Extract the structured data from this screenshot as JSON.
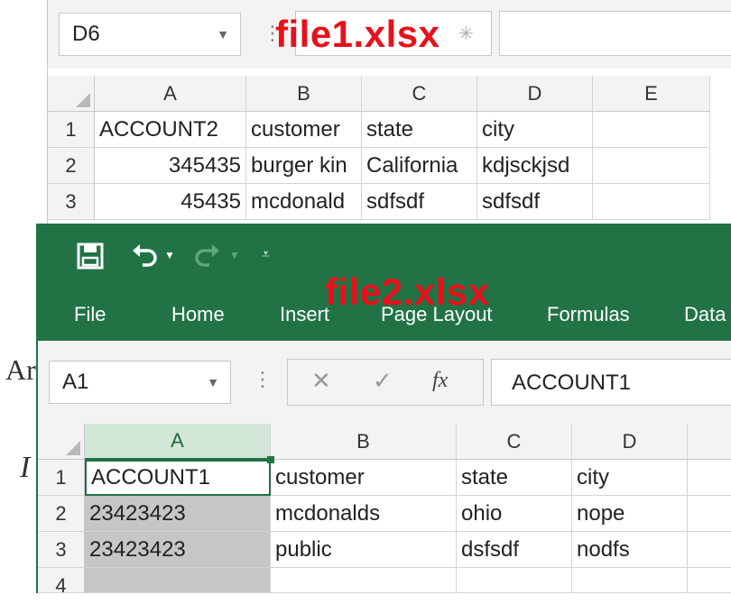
{
  "background": {
    "fragment_1": "Ar",
    "fragment_2": "I"
  },
  "file1": {
    "label": "file1.xlsx",
    "name_box": "D6",
    "formula_value": "",
    "column_headers": [
      "A",
      "B",
      "C",
      "D",
      "E"
    ],
    "row_headers": [
      "1",
      "2",
      "3"
    ],
    "rows": [
      [
        "ACCOUNT2",
        "customer",
        "state",
        "city",
        ""
      ],
      [
        "345435",
        "burger kin",
        "California",
        "kdjsckjsd",
        ""
      ],
      [
        "45435",
        "mcdonald",
        "sdfsdf",
        "sdfsdf",
        ""
      ]
    ]
  },
  "file2": {
    "label": "file2.xlsx",
    "ribbon_tabs": [
      "File",
      "Home",
      "Insert",
      "Page Layout",
      "Formulas",
      "Data"
    ],
    "name_box": "A1",
    "formula_value": "ACCOUNT1",
    "fx_label": "fx",
    "column_headers": [
      "A",
      "B",
      "C",
      "D"
    ],
    "row_headers": [
      "1",
      "2",
      "3",
      "4"
    ],
    "rows": [
      [
        "ACCOUNT1",
        "customer",
        "state",
        "city"
      ],
      [
        "23423423",
        "mcdonalds",
        "ohio",
        "nope"
      ],
      [
        "23423423",
        "public",
        "dsfsdf",
        "nodfs"
      ],
      [
        "",
        "",
        "",
        ""
      ]
    ]
  },
  "colors": {
    "excel_green": "#217346",
    "label_red": "#e8111b",
    "selection_gray": "#c6c6c6"
  }
}
